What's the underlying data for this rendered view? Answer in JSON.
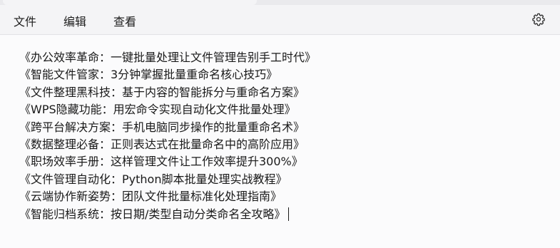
{
  "menu": {
    "file": "文件",
    "edit": "编辑",
    "view": "查看",
    "settings_icon": "gear-icon"
  },
  "editor": {
    "lines": [
      "《办公效率革命：一键批量处理让文件管理告别手工时代》",
      "《智能文件管家：3分钟掌握批量重命名核心技巧》",
      "《文件整理黑科技：基于内容的智能拆分与重命名方案》",
      "《WPS隐藏功能：用宏命令实现自动化文件批量处理》",
      "《跨平台解决方案：手机电脑同步操作的批量重命名术》",
      "《数据整理必备：正则表达式在批量命名中的高阶应用》",
      "《职场效率手册：这样管理文件让工作效率提升300%》",
      "《文件管理自动化：Python脚本批量处理实战教程》",
      "《云端协作新姿势：团队文件批量标准化处理指南》",
      "《智能归档系统：按日期/类型自动分类命名全攻略》"
    ]
  }
}
